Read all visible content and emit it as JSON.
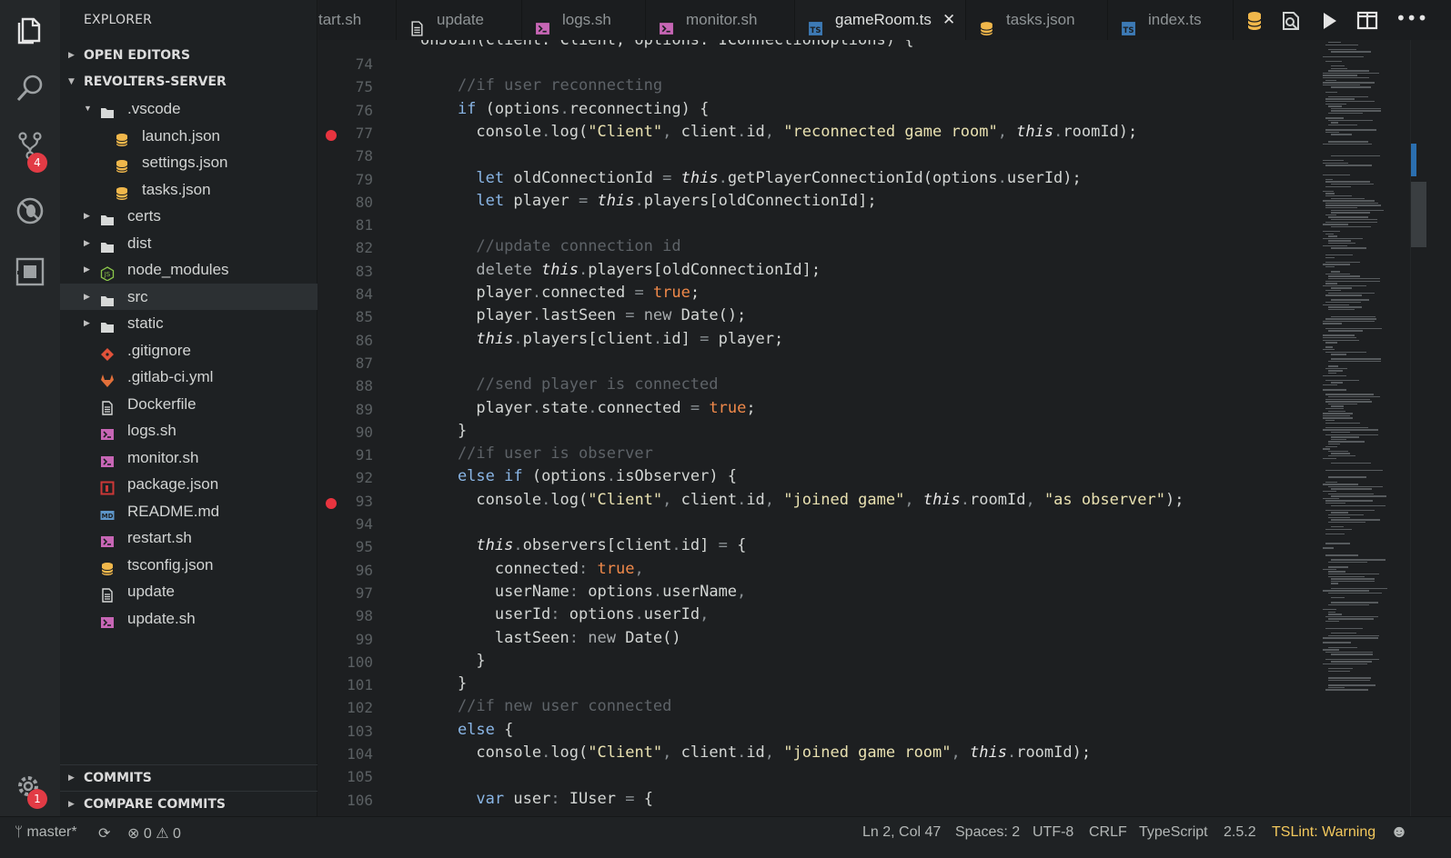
{
  "sidebar": {
    "title": "EXPLORER",
    "open_editors": "OPEN EDITORS",
    "project": "REVOLTERS-SERVER",
    "items": [
      {
        "label": ".vscode",
        "kind": "folder-open",
        "depth": 1
      },
      {
        "label": "launch.json",
        "kind": "json",
        "depth": 2
      },
      {
        "label": "settings.json",
        "kind": "json",
        "depth": 2
      },
      {
        "label": "tasks.json",
        "kind": "json",
        "depth": 2
      },
      {
        "label": "certs",
        "kind": "folder",
        "depth": 1
      },
      {
        "label": "dist",
        "kind": "folder",
        "depth": 1
      },
      {
        "label": "node_modules",
        "kind": "node-folder",
        "depth": 1
      },
      {
        "label": "src",
        "kind": "folder",
        "depth": 1
      },
      {
        "label": "static",
        "kind": "folder",
        "depth": 1
      },
      {
        "label": ".gitignore",
        "kind": "git",
        "depth": 1
      },
      {
        "label": ".gitlab-ci.yml",
        "kind": "gitlab",
        "depth": 1
      },
      {
        "label": "Dockerfile",
        "kind": "file",
        "depth": 1
      },
      {
        "label": "logs.sh",
        "kind": "shell",
        "depth": 1
      },
      {
        "label": "monitor.sh",
        "kind": "shell",
        "depth": 1
      },
      {
        "label": "package.json",
        "kind": "npm",
        "depth": 1
      },
      {
        "label": "README.md",
        "kind": "md",
        "depth": 1
      },
      {
        "label": "restart.sh",
        "kind": "shell",
        "depth": 1
      },
      {
        "label": "tsconfig.json",
        "kind": "json",
        "depth": 1
      },
      {
        "label": "update",
        "kind": "file",
        "depth": 1
      },
      {
        "label": "update.sh",
        "kind": "shell",
        "depth": 1
      }
    ],
    "commits": "COMMITS",
    "compare_commits": "COMPARE COMMITS"
  },
  "activity": {
    "scm_badge": "4",
    "settings_badge": "1"
  },
  "tabs": [
    {
      "label": "tart.sh",
      "kind": "none"
    },
    {
      "label": "update",
      "kind": "file"
    },
    {
      "label": "logs.sh",
      "kind": "shell"
    },
    {
      "label": "monitor.sh",
      "kind": "shell"
    },
    {
      "label": "gameRoom.ts",
      "kind": "ts",
      "active": true,
      "close": "✕"
    },
    {
      "label": "tasks.json",
      "kind": "json"
    },
    {
      "label": "index.ts",
      "kind": "ts"
    }
  ],
  "editor": {
    "partial_top_line": "onJoin(client: Client, options: IConnectionOptions) {",
    "lines": [
      {
        "n": "74",
        "c": []
      },
      {
        "n": "75",
        "c": [
          [
            "cm",
            "    //if user reconnecting"
          ]
        ]
      },
      {
        "n": "76",
        "c": [
          [
            "kw",
            "    if"
          ],
          [
            "pr",
            " (options"
          ],
          [
            "op",
            "."
          ],
          [
            "pr",
            "reconnecting) {"
          ]
        ]
      },
      {
        "n": "77",
        "bp": true,
        "c": [
          [
            "pr",
            "      console"
          ],
          [
            "op",
            "."
          ],
          [
            "pr",
            "log("
          ],
          [
            "st",
            "\"Client\""
          ],
          [
            "op",
            ","
          ],
          [
            "pr",
            " client"
          ],
          [
            "op",
            "."
          ],
          [
            "pr",
            "id"
          ],
          [
            "op",
            ","
          ],
          [
            "st",
            " \"reconnected game room\""
          ],
          [
            "op",
            ","
          ],
          [
            "th",
            " this"
          ],
          [
            "op",
            "."
          ],
          [
            "pr",
            "roomId);"
          ]
        ]
      },
      {
        "n": "78",
        "c": []
      },
      {
        "n": "79",
        "c": [
          [
            "kw",
            "      let"
          ],
          [
            "pr",
            " oldConnectionId "
          ],
          [
            "op",
            "="
          ],
          [
            "th",
            " this"
          ],
          [
            "op",
            "."
          ],
          [
            "pr",
            "getPlayerConnectionId(options"
          ],
          [
            "op",
            "."
          ],
          [
            "pr",
            "userId);"
          ]
        ]
      },
      {
        "n": "80",
        "c": [
          [
            "kw",
            "      let"
          ],
          [
            "pr",
            " player "
          ],
          [
            "op",
            "="
          ],
          [
            "th",
            " this"
          ],
          [
            "op",
            "."
          ],
          [
            "pr",
            "players[oldConnectionId];"
          ]
        ]
      },
      {
        "n": "81",
        "c": []
      },
      {
        "n": "82",
        "c": [
          [
            "cm",
            "      //update connection id"
          ]
        ]
      },
      {
        "n": "83",
        "c": [
          [
            "nw",
            "      delete"
          ],
          [
            "th",
            " this"
          ],
          [
            "op",
            "."
          ],
          [
            "pr",
            "players[oldConnectionId];"
          ]
        ]
      },
      {
        "n": "84",
        "c": [
          [
            "pr",
            "      player"
          ],
          [
            "op",
            "."
          ],
          [
            "pr",
            "connected "
          ],
          [
            "op",
            "="
          ],
          [
            "bo",
            " true"
          ],
          [
            "pr",
            ";"
          ]
        ]
      },
      {
        "n": "85",
        "c": [
          [
            "pr",
            "      player"
          ],
          [
            "op",
            "."
          ],
          [
            "pr",
            "lastSeen "
          ],
          [
            "op",
            "="
          ],
          [
            "nw",
            " new"
          ],
          [
            "pr",
            " Date();"
          ]
        ]
      },
      {
        "n": "86",
        "c": [
          [
            "th",
            "      this"
          ],
          [
            "op",
            "."
          ],
          [
            "pr",
            "players[client"
          ],
          [
            "op",
            "."
          ],
          [
            "pr",
            "id] "
          ],
          [
            "op",
            "="
          ],
          [
            "pr",
            " player;"
          ]
        ]
      },
      {
        "n": "87",
        "c": []
      },
      {
        "n": "88",
        "c": [
          [
            "cm",
            "      //send player is connected"
          ]
        ]
      },
      {
        "n": "89",
        "c": [
          [
            "pr",
            "      player"
          ],
          [
            "op",
            "."
          ],
          [
            "pr",
            "state"
          ],
          [
            "op",
            "."
          ],
          [
            "pr",
            "connected "
          ],
          [
            "op",
            "="
          ],
          [
            "bo",
            " true"
          ],
          [
            "pr",
            ";"
          ]
        ]
      },
      {
        "n": "90",
        "c": [
          [
            "pr",
            "    }"
          ]
        ]
      },
      {
        "n": "91",
        "c": [
          [
            "cm",
            "    //if user is observer"
          ]
        ]
      },
      {
        "n": "92",
        "c": [
          [
            "kw",
            "    else if"
          ],
          [
            "pr",
            " (options"
          ],
          [
            "op",
            "."
          ],
          [
            "pr",
            "isObserver) {"
          ]
        ]
      },
      {
        "n": "93",
        "bp": true,
        "c": [
          [
            "pr",
            "      console"
          ],
          [
            "op",
            "."
          ],
          [
            "pr",
            "log("
          ],
          [
            "st",
            "\"Client\""
          ],
          [
            "op",
            ","
          ],
          [
            "pr",
            " client"
          ],
          [
            "op",
            "."
          ],
          [
            "pr",
            "id"
          ],
          [
            "op",
            ","
          ],
          [
            "st",
            " \"joined game\""
          ],
          [
            "op",
            ","
          ],
          [
            "th",
            " this"
          ],
          [
            "op",
            "."
          ],
          [
            "pr",
            "roomId"
          ],
          [
            "op",
            ","
          ],
          [
            "st",
            " \"as observer\""
          ],
          [
            "pr",
            ");"
          ]
        ]
      },
      {
        "n": "94",
        "c": []
      },
      {
        "n": "95",
        "c": [
          [
            "th",
            "      this"
          ],
          [
            "op",
            "."
          ],
          [
            "pr",
            "observers[client"
          ],
          [
            "op",
            "."
          ],
          [
            "pr",
            "id] "
          ],
          [
            "op",
            "="
          ],
          [
            "pr",
            " {"
          ]
        ]
      },
      {
        "n": "96",
        "c": [
          [
            "pr",
            "        connected"
          ],
          [
            "op",
            ":"
          ],
          [
            "bo",
            " true"
          ],
          [
            "op",
            ","
          ]
        ]
      },
      {
        "n": "97",
        "c": [
          [
            "pr",
            "        userName"
          ],
          [
            "op",
            ":"
          ],
          [
            "pr",
            " options"
          ],
          [
            "op",
            "."
          ],
          [
            "pr",
            "userName"
          ],
          [
            "op",
            ","
          ]
        ]
      },
      {
        "n": "98",
        "c": [
          [
            "pr",
            "        userId"
          ],
          [
            "op",
            ":"
          ],
          [
            "pr",
            " options"
          ],
          [
            "op",
            "."
          ],
          [
            "pr",
            "userId"
          ],
          [
            "op",
            ","
          ]
        ]
      },
      {
        "n": "99",
        "c": [
          [
            "pr",
            "        lastSeen"
          ],
          [
            "op",
            ":"
          ],
          [
            "nw",
            " new"
          ],
          [
            "pr",
            " Date()"
          ]
        ]
      },
      {
        "n": "100",
        "c": [
          [
            "pr",
            "      }"
          ]
        ]
      },
      {
        "n": "101",
        "c": [
          [
            "pr",
            "    }"
          ]
        ]
      },
      {
        "n": "102",
        "c": [
          [
            "cm",
            "    //if new user connected"
          ]
        ]
      },
      {
        "n": "103",
        "c": [
          [
            "kw",
            "    else"
          ],
          [
            "pr",
            " {"
          ]
        ]
      },
      {
        "n": "104",
        "c": [
          [
            "pr",
            "      console"
          ],
          [
            "op",
            "."
          ],
          [
            "pr",
            "log("
          ],
          [
            "st",
            "\"Client\""
          ],
          [
            "op",
            ","
          ],
          [
            "pr",
            " client"
          ],
          [
            "op",
            "."
          ],
          [
            "pr",
            "id"
          ],
          [
            "op",
            ","
          ],
          [
            "st",
            " \"joined game room\""
          ],
          [
            "op",
            ","
          ],
          [
            "th",
            " this"
          ],
          [
            "op",
            "."
          ],
          [
            "pr",
            "roomId);"
          ]
        ]
      },
      {
        "n": "105",
        "c": []
      },
      {
        "n": "106",
        "c": [
          [
            "kw",
            "      var"
          ],
          [
            "pr",
            " user"
          ],
          [
            "op",
            ":"
          ],
          [
            "pr",
            " IUser "
          ],
          [
            "op",
            "="
          ],
          [
            "pr",
            " {"
          ]
        ]
      }
    ]
  },
  "status": {
    "branch": "master*",
    "errors": "0",
    "warnings": "0",
    "position": "Ln 2, Col 47",
    "spaces": "Spaces: 2",
    "encoding": "UTF-8",
    "eol": "CRLF",
    "language": "TypeScript",
    "version": "2.5.2",
    "lint": "TSLint: Warning"
  },
  "colors": {
    "accent_error": "#e23b45",
    "json_icon": "#f0b74b",
    "shell_icon": "#c766b5",
    "ts_icon": "#3d7ab5",
    "lint_warning": "#f4c95d"
  }
}
